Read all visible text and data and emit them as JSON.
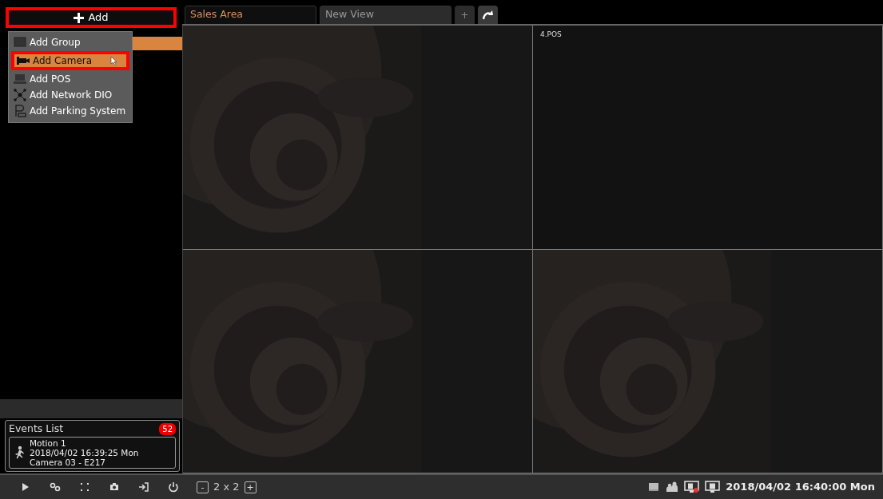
{
  "add_button": {
    "label": "Add",
    "highlighted": true
  },
  "tree_row": {
    "selected": true
  },
  "add_menu": [
    {
      "label": "Add Group",
      "kind": "group",
      "selected": false,
      "highlighted": false
    },
    {
      "label": "Add Camera",
      "kind": "camera",
      "selected": true,
      "highlighted": true
    },
    {
      "label": "Add POS",
      "kind": "pos",
      "selected": false,
      "highlighted": false
    },
    {
      "label": "Add Network DIO",
      "kind": "dio",
      "selected": false,
      "highlighted": false
    },
    {
      "label": "Add Parking System",
      "kind": "parking",
      "selected": false,
      "highlighted": false
    }
  ],
  "tabs": [
    {
      "label": "Sales Area",
      "selected": true
    },
    {
      "label": "New View",
      "selected": false
    }
  ],
  "tab_add": "+",
  "cells": [
    {
      "kind": "picture"
    },
    {
      "kind": "empty",
      "label": "4.POS"
    },
    {
      "kind": "picture"
    },
    {
      "kind": "picture"
    }
  ],
  "events": {
    "title": "Events List",
    "count": "52",
    "items": [
      {
        "lines": [
          "Motion 1",
          "2018/04/02 16:39:25 Mon",
          "Camera 03 - E217"
        ]
      }
    ]
  },
  "layout": {
    "decrease": "-",
    "label": "2 x 2",
    "increase": "+"
  },
  "clock": "2018/04/02 16:40:00 Mon"
}
